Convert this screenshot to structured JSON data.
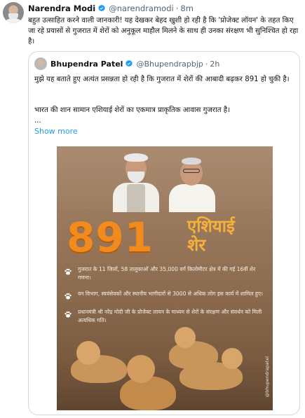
{
  "tweet": {
    "author_name": "Narendra Modi",
    "author_handle": "@narendramodi",
    "separator": "·",
    "time": "8m",
    "text": "बहुत उत्साहित करने वाली जानकारी! यह देखकर बेहद खुशी हो रही है कि 'प्रोजेक्ट लॉयन' के तहत किए जा रहे प्रयासों से गुजरात में शेरों को अनुकूल माहौल मिलने के साथ ही उनका संरक्षण भी सुनिश्चित हो रहा है।"
  },
  "quote": {
    "author_name": "Bhupendra Patel",
    "author_handle": "@Bhupendrapbjp",
    "separator": "·",
    "time": "2h",
    "text_line1": "मुझे यह बताते हुए अत्यंत प्रसन्नता हो रही है कि गुजरात में शेरों की आबादी बढ़कर 891 हो चुकी है।",
    "text_line2": "भारत की शान सामान एशियाई शेरों का एकमात्र प्राकृतिक आवास गुजरात है।",
    "ellipsis": "...",
    "show_more": "Show more"
  },
  "poster": {
    "number": "891",
    "word_line1": "एशियाई",
    "word_line2": "शेर",
    "facts": [
      "गुजरात के 11 जिलों, 58 तालुकाओं और 35,000 वर्ग किलोमीटर क्षेत्र में की गई 16वीं शेर गणना।",
      "वन विभाग, स्वयंसेवकों और स्थानीय भागीदारों से 3000 से अधिक लोग इस कार्य में शामिल हुए।",
      "प्रधानमंत्री श्री नरेंद्र मोदी जी के प्रोजेक्ट लायन के माध्यम से शेरों के संरक्षण और संवर्धन को मिली अत्यधिक गति।"
    ],
    "watermark": "@bhupendrapatel"
  },
  "colors": {
    "link": "#1d9bf0",
    "verified": "#1d9bf0",
    "accent_number": "#f28b1e"
  },
  "icons": {
    "verified": "verified-badge-icon",
    "paw": "paw-icon"
  }
}
